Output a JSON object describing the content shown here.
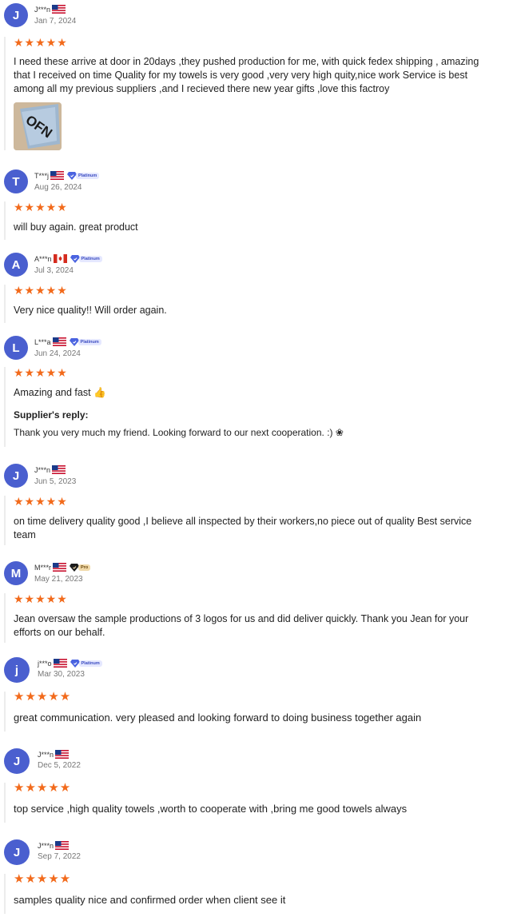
{
  "colors": {
    "avatar_bg": "#4a5fcf",
    "star": "#f26a1b",
    "platinum_bg": "#e5e8ff",
    "pro_bg": "#f1d9a8"
  },
  "star_glyph": "★★★★★",
  "reviews": [
    {
      "initial": "J",
      "name": "J***n",
      "flag": "us",
      "badge": "",
      "date": "Jan 7, 2024",
      "rating": 5,
      "text": "I need these arrive at door in 20days ,they pushed production for me, with quick fedex shipping , amazing that I received on time Quality for my towels is very good ,very very high quity,nice work Service is best among all my previous suppliers ,and I recieved there new year gifts ,love this factroy"
    },
    {
      "initial": "T",
      "name": "T***j",
      "flag": "us",
      "badge": "Platinum",
      "date": "Aug 26, 2024",
      "rating": 5,
      "text": "will buy again. great product"
    },
    {
      "initial": "A",
      "name": "A***n",
      "flag": "ca",
      "badge": "Platinum",
      "date": "Jul 3, 2024",
      "rating": 5,
      "text": "Very nice quality!! Will order again."
    },
    {
      "initial": "L",
      "name": "L***a",
      "flag": "us",
      "badge": "Platinum",
      "date": "Jun 24, 2024",
      "rating": 5,
      "text": "Amazing and fast 👍",
      "reply_title": "Supplier's reply:",
      "reply_text": "Thank you very much my friend. Looking forward to our next cooperation. :) ❀"
    },
    {
      "initial": "J",
      "name": "J***n",
      "flag": "us",
      "badge": "",
      "date": "Jun 5, 2023",
      "rating": 5,
      "text": "on time delivery quality good ,I believe all inspected by their workers,no piece out of quality Best service team"
    },
    {
      "initial": "M",
      "name": "M***r",
      "flag": "us",
      "badge": "Pro",
      "date": "May 21, 2023",
      "rating": 5,
      "text": "Jean oversaw the sample productions of 3 logos for us and did deliver quickly. Thank you Jean for your efforts on our behalf."
    },
    {
      "initial": "j",
      "name": "j***o",
      "flag": "us",
      "badge": "Platinum",
      "date": "Mar 30, 2023",
      "rating": 5,
      "text": "great communication. very pleased and looking forward to doing business together again"
    },
    {
      "initial": "J",
      "name": "J***n",
      "flag": "us",
      "badge": "",
      "date": "Dec 5, 2022",
      "rating": 5,
      "text": "top service ,high quality towels ,worth to cooperate with ,bring me good towels always"
    },
    {
      "initial": "J",
      "name": "J***n",
      "flag": "us",
      "badge": "",
      "date": "Sep 7, 2022",
      "rating": 5,
      "text": "samples quality nice and confirmed order when client see it"
    }
  ]
}
